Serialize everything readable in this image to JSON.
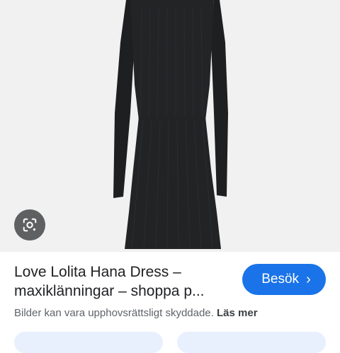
{
  "product": {
    "title_line1": "Love Lolita Hana Dress –",
    "title_line2": "maxiklänningar – shoppa p..."
  },
  "actions": {
    "visit_label": "Besök",
    "visit_chevron": "›"
  },
  "disclaimer": {
    "text": "Bilder kan vara upphovsrättsligt skyddade.",
    "more_label": "Läs mer"
  },
  "colors": {
    "image_background": "#f1f1f1",
    "dress": "#222325",
    "accent": "#1a73e8",
    "lens_button": "#5f6062"
  },
  "icons": {
    "lens": "google-lens-icon",
    "visit": "chevron-right-icon"
  }
}
